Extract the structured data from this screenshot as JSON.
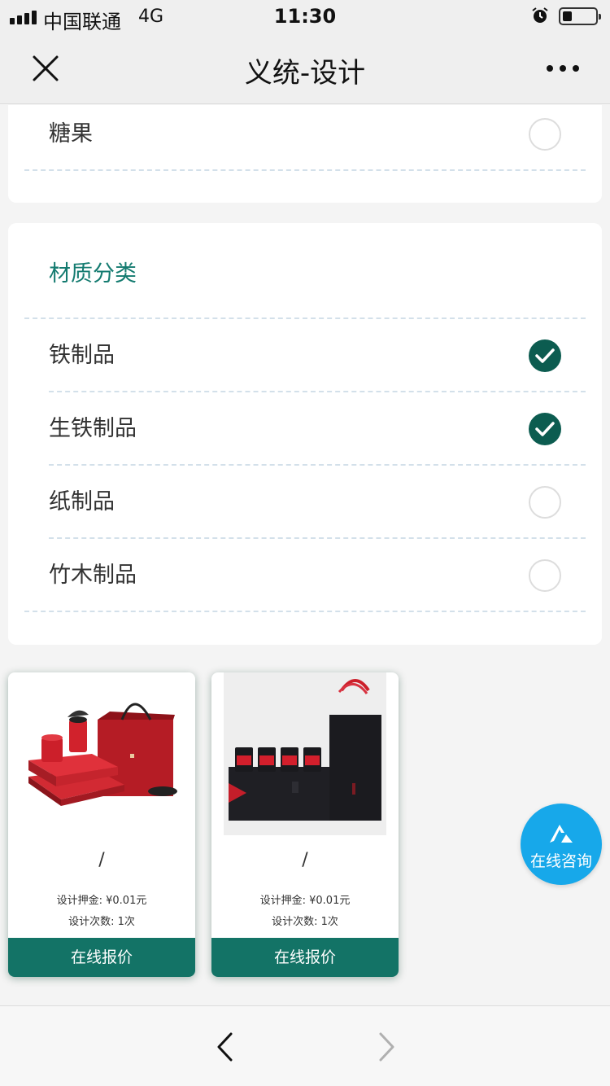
{
  "status_bar": {
    "carrier": "中国联通",
    "network": "4G",
    "time": "11:30",
    "signal_bars": 4,
    "battery_level": 0.25
  },
  "nav": {
    "title": "义统-设计",
    "close_icon": "close-icon",
    "more_icon": "more-icon"
  },
  "top_section": {
    "items": [
      {
        "label": "糖果",
        "checked": false
      }
    ]
  },
  "material_section": {
    "title": "材质分类",
    "items": [
      {
        "label": "铁制品",
        "checked": true
      },
      {
        "label": "生铁制品",
        "checked": true
      },
      {
        "label": "纸制品",
        "checked": false
      },
      {
        "label": "竹木制品",
        "checked": false
      }
    ]
  },
  "products": [
    {
      "name": "/",
      "deposit": "设计押金: ¥0.01元",
      "count": "设计次数: 1次",
      "button": "在线报价",
      "image": "red-tea-gift-box-image"
    },
    {
      "name": "/",
      "deposit": "设计押金: ¥0.01元",
      "count": "设计次数: 1次",
      "button": "在线报价",
      "image": "black-tea-gift-box-image"
    }
  ],
  "consult": {
    "label": "在线咨询",
    "icon": "consult-logo-icon"
  },
  "bottom_bar": {
    "back_icon": "chevron-left-icon",
    "forward_icon": "chevron-right-icon"
  },
  "colors": {
    "accent": "#137366",
    "check": "#0c5c50",
    "section_title": "#147b70",
    "consult": "#17a8ea"
  }
}
